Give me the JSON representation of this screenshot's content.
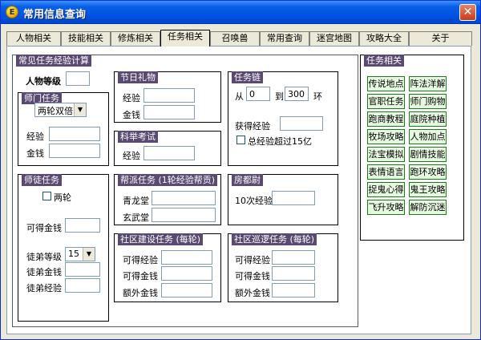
{
  "window": {
    "title": "常用信息查询",
    "app_icon": "E"
  },
  "tabs": [
    "人物相关",
    "技能相关",
    "修炼相关",
    "任务相关",
    "召唤兽",
    "常用查询",
    "迷宫地图",
    "攻略大全",
    "关于"
  ],
  "main": {
    "title": "常见任务经验计算",
    "char_level_label": "人物等级",
    "shimen": {
      "title": "师门任务",
      "mode": "两轮双倍",
      "exp_label": "经验",
      "money_label": "金钱"
    },
    "holiday": {
      "title": "节日礼物",
      "exp_label": "经验",
      "money_label": "金钱"
    },
    "keju": {
      "title": "科举考试",
      "exp_label": "经验"
    },
    "chain": {
      "title": "任务链",
      "from_label": "从",
      "from_value": "0",
      "to_label": "到",
      "to_value": "300",
      "ring_label": "环",
      "gain_label": "获得经验",
      "over_label": "总经验超过15亿"
    },
    "apprentice": {
      "title": "师徒任务",
      "two_rounds": "两轮",
      "money_label": "可得金钱",
      "level_label": "徒弟等级",
      "level_value": "15",
      "app_money_label": "徒弟金钱",
      "app_exp_label": "徒弟经验"
    },
    "guild": {
      "title": "帮派任务 (1轮经验帮贡)",
      "qinglong": "青龙堂",
      "xuanwu": "玄武堂"
    },
    "fangdu": {
      "title": "房都尉",
      "exp10": "10次经验"
    },
    "build": {
      "title": "社区建设任务 (每轮)",
      "exp": "可得经验",
      "money": "可得金钱",
      "extra": "额外金钱"
    },
    "patrol": {
      "title": "社区巡逻任务 (每轮)",
      "exp": "可得经验",
      "money": "可得金钱",
      "extra": "额外金钱"
    }
  },
  "side": {
    "title": "任务相关",
    "buttons": [
      "传说地点",
      "阵法洋解",
      "官职任务",
      "师门购物",
      "跑商教程",
      "庭院种植",
      "牧场攻略",
      "人物加点",
      "法宝模拟",
      "剧情技能",
      "表情语言",
      "跑环攻略",
      "捉鬼心得",
      "鬼王攻略",
      "飞升攻略",
      "解防沉迷"
    ]
  }
}
